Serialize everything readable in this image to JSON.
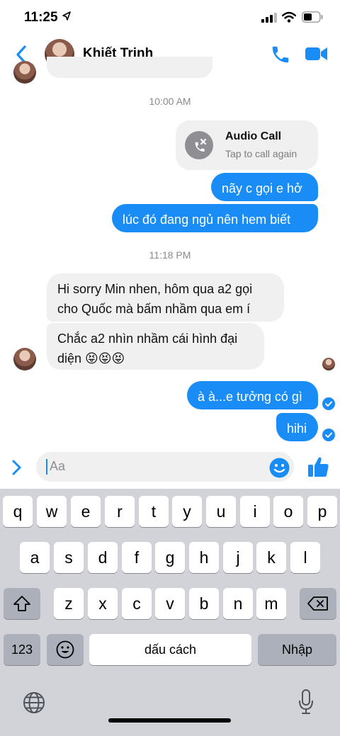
{
  "status_bar": {
    "time": "11:25"
  },
  "header": {
    "contact_name": "Khiết Trinh"
  },
  "messages": {
    "time_1": "10:00 AM",
    "call_title": "Audio Call",
    "call_subtitle": "Tap to call again",
    "out_1": "nãy c gọi e hở",
    "out_2": "lúc đó đang ngủ nên hem biết",
    "time_2": "11:18 PM",
    "in_1_line_1": "Hi sorry Min nhen, hôm qua a2 gọi",
    "in_1_line_2": "cho Quốc mà bấm nhầm qua em í",
    "in_2_line_1": "Chắc a2 nhìn nhầm cái hình đại",
    "in_2_line_2": "diện 😝😝😝",
    "out_3": "à à...e tưởng có gì",
    "out_4": "hihi"
  },
  "composer": {
    "placeholder": "Aa"
  },
  "keyboard": {
    "row1": [
      "q",
      "w",
      "e",
      "r",
      "t",
      "y",
      "u",
      "i",
      "o",
      "p"
    ],
    "row2": [
      "a",
      "s",
      "d",
      "f",
      "g",
      "h",
      "j",
      "k",
      "l"
    ],
    "row3": [
      "z",
      "x",
      "c",
      "v",
      "b",
      "n",
      "m"
    ],
    "numbers_label": "123",
    "space_label": "dấu cách",
    "return_label": "Nhập"
  },
  "colors": {
    "accent": "#1a8cf5",
    "incoming_bubble": "#f0f0f0",
    "keyboard_bg": "#d1d3d9"
  }
}
